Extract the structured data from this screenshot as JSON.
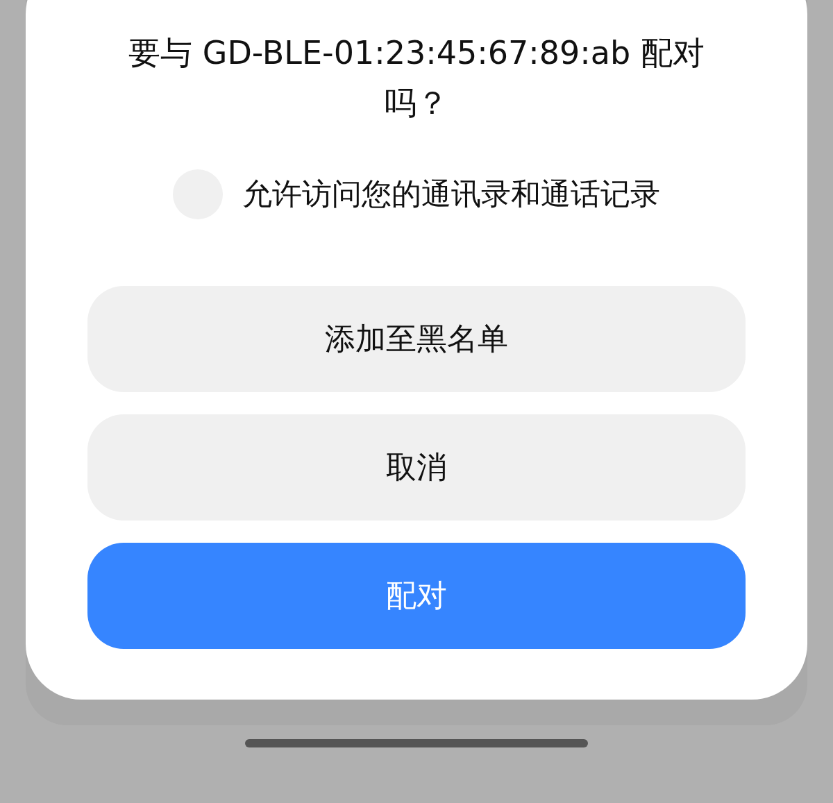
{
  "dialog": {
    "title": "要与 GD-BLE-01:23:45:67:89:ab 配对吗？",
    "permission": {
      "label": "允许访问您的通讯录和通话记录",
      "checked": false
    },
    "buttons": [
      {
        "label": "添加至黑名单",
        "kind": "secondary"
      },
      {
        "label": "取消",
        "kind": "secondary"
      },
      {
        "label": "配对",
        "kind": "primary"
      }
    ]
  }
}
